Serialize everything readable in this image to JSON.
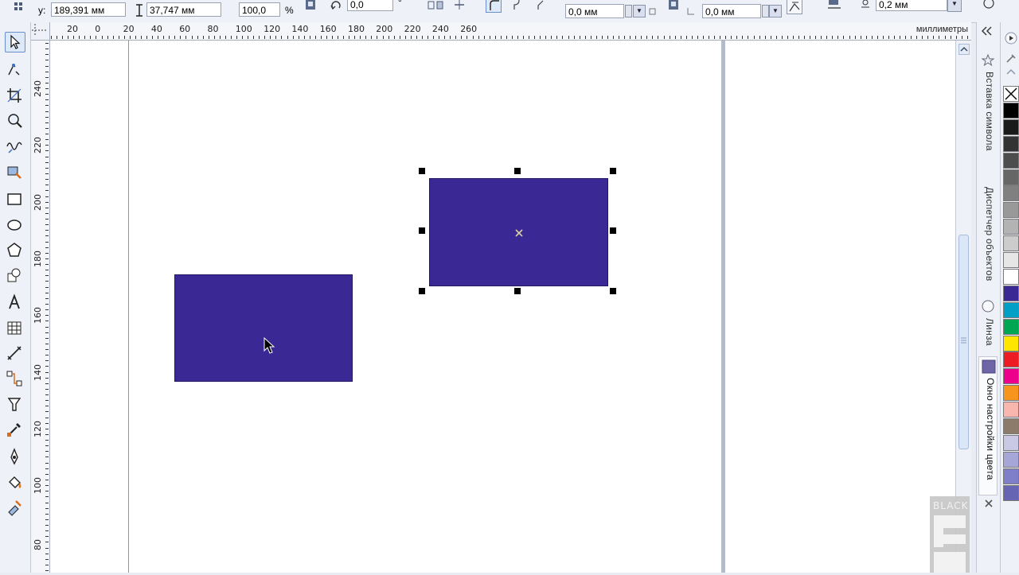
{
  "propbar": {
    "y_label": "y:",
    "y_value": "189,391 мм",
    "height_value": "37,747 мм",
    "scale_value": "100,0",
    "percent": "%",
    "angle_value": "0,0",
    "corner_left_value": "0,0 мм",
    "corner_right_value": "0,0 мм",
    "outline_value": "0,2 мм"
  },
  "ruler": {
    "units": "миллиметры",
    "h_labels": [
      "20",
      "0",
      "20",
      "40",
      "60",
      "80",
      "100",
      "120",
      "140",
      "160",
      "180",
      "200",
      "220",
      "240",
      "260"
    ],
    "v_labels": [
      "240",
      "220",
      "200",
      "180",
      "160",
      "140",
      "120",
      "100",
      "80"
    ]
  },
  "toolbox": {
    "tools": [
      "pick-tool",
      "shape-tool",
      "crop-tool",
      "zoom-tool",
      "freehand-tool",
      "smart-fill-tool",
      "rectangle-tool",
      "ellipse-tool",
      "polygon-tool",
      "basic-shapes-tool",
      "text-tool",
      "table-tool",
      "dimension-tool",
      "connector-tool",
      "blend-tool",
      "eyedropper-tool",
      "outline-tool",
      "fill-tool",
      "interactive-fill-tool"
    ]
  },
  "docker": {
    "tab_insert_char": "Вставка символа",
    "tab_object_manager": "Диспетчер объектов",
    "tab_lens": "Линза",
    "tab_color_settings": "Окно настройки цвета"
  },
  "watermark": {
    "text": "BLACK"
  },
  "colors": {
    "object_fill": "#3a2894",
    "selection_handle": "#000000"
  },
  "palette": [
    "none",
    "#000000",
    "#1a1a1a",
    "#333333",
    "#4d4d4d",
    "#666666",
    "#808080",
    "#999999",
    "#b3b3b3",
    "#cccccc",
    "#e6e6e6",
    "#ffffff",
    "#3a2894",
    "#00a0c6",
    "#00a651",
    "#ffe600",
    "#ed1c24",
    "#ec008c",
    "#f7941d",
    "#f9b6ae",
    "#8c7b6b",
    "#c9c9e6",
    "#a6a6d9",
    "#7f7fc9",
    "#6565b3"
  ]
}
